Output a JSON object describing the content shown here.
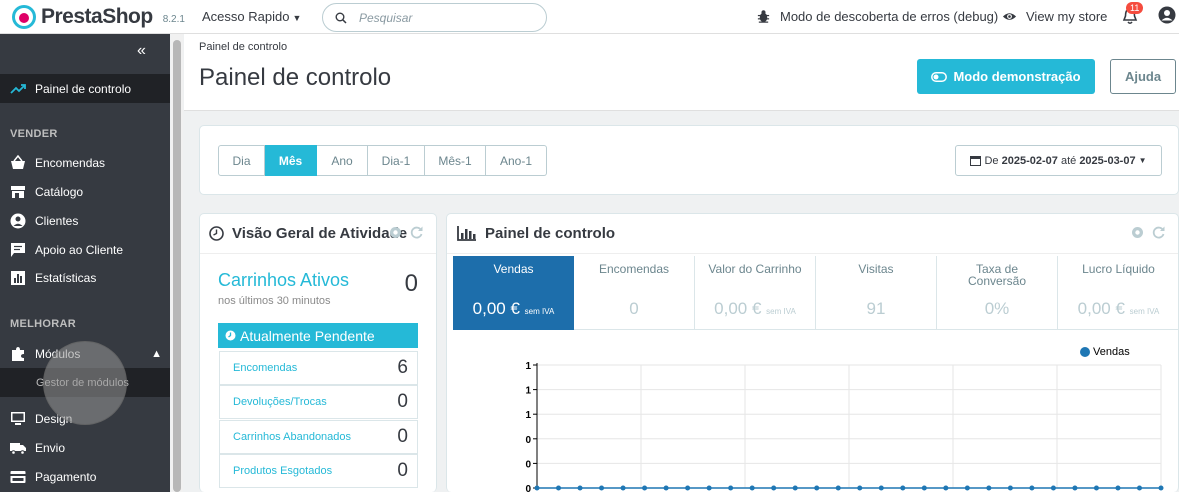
{
  "header": {
    "brand": "PrestaShop",
    "version": "8.2.1",
    "quick_access": "Acesso Rapido",
    "search_placeholder": "Pesquisar",
    "debug_mode": "Modo de descoberta de erros (debug)",
    "view_store": "View my store",
    "notifications_count": "11"
  },
  "sidebar": {
    "dashboard": "Painel de controlo",
    "section_sell": "VENDER",
    "sell_items": [
      "Encomendas",
      "Catálogo",
      "Clientes",
      "Apoio ao Cliente",
      "Estatísticas"
    ],
    "section_improve": "MELHORAR",
    "modules": "Módulos",
    "module_manager": "Gestor de módulos",
    "improve_items": [
      "Design",
      "Envio",
      "Pagamento"
    ]
  },
  "page": {
    "breadcrumb": "Painel de controlo",
    "title": "Painel de controlo",
    "demo_button": "Modo demonstração",
    "help_button": "Ajuda"
  },
  "periods": {
    "buttons": [
      "Dia",
      "Mês",
      "Ano",
      "Dia-1",
      "Mês-1",
      "Ano-1"
    ],
    "active": "Mês",
    "range_prefix": "De",
    "range_from": "2025-02-07",
    "range_sep": "até",
    "range_to": "2025-03-07"
  },
  "activity": {
    "title": "Visão Geral de Atividade",
    "active_carts_label": "Carrinhos Ativos",
    "active_carts_value": "0",
    "active_carts_sub": "nos últimos 30 minutos",
    "pending_title": "Atualmente Pendente",
    "pending": [
      {
        "label": "Encomendas",
        "value": "6"
      },
      {
        "label": "Devoluções/Trocas",
        "value": "0"
      },
      {
        "label": "Carrinhos Abandonados",
        "value": "0"
      },
      {
        "label": "Produtos Esgotados",
        "value": "0"
      }
    ]
  },
  "dashboard": {
    "title": "Painel de controlo",
    "kpis": [
      {
        "label": "Vendas",
        "value": "0,00 €",
        "suffix": "sem IVA"
      },
      {
        "label": "Encomendas",
        "value": "0",
        "suffix": ""
      },
      {
        "label": "Valor do Carrinho",
        "value": "0,00 €",
        "suffix": "sem IVA"
      },
      {
        "label": "Visitas",
        "value": "91",
        "suffix": ""
      },
      {
        "label": "Taxa de Conversão",
        "value": "0%",
        "suffix": ""
      },
      {
        "label": "Lucro Líquido",
        "value": "0,00 €",
        "suffix": "sem IVA"
      }
    ],
    "legend": "Vendas",
    "series_color": "#1f77b4"
  },
  "chart_data": {
    "type": "line",
    "series": [
      {
        "name": "Vendas",
        "values": [
          0,
          0,
          0,
          0,
          0,
          0,
          0,
          0,
          0,
          0,
          0,
          0,
          0,
          0,
          0,
          0,
          0,
          0,
          0,
          0,
          0,
          0,
          0,
          0,
          0,
          0,
          0,
          0,
          0,
          0
        ]
      }
    ],
    "y_tick_labels": [
      "1",
      "1",
      "1",
      "0",
      "0",
      "0"
    ],
    "grid": true,
    "legend_position": "top-right"
  },
  "colors": {
    "accent": "#25b9d7",
    "sidebar": "#363a41",
    "kpi_active": "#1d6eab"
  }
}
